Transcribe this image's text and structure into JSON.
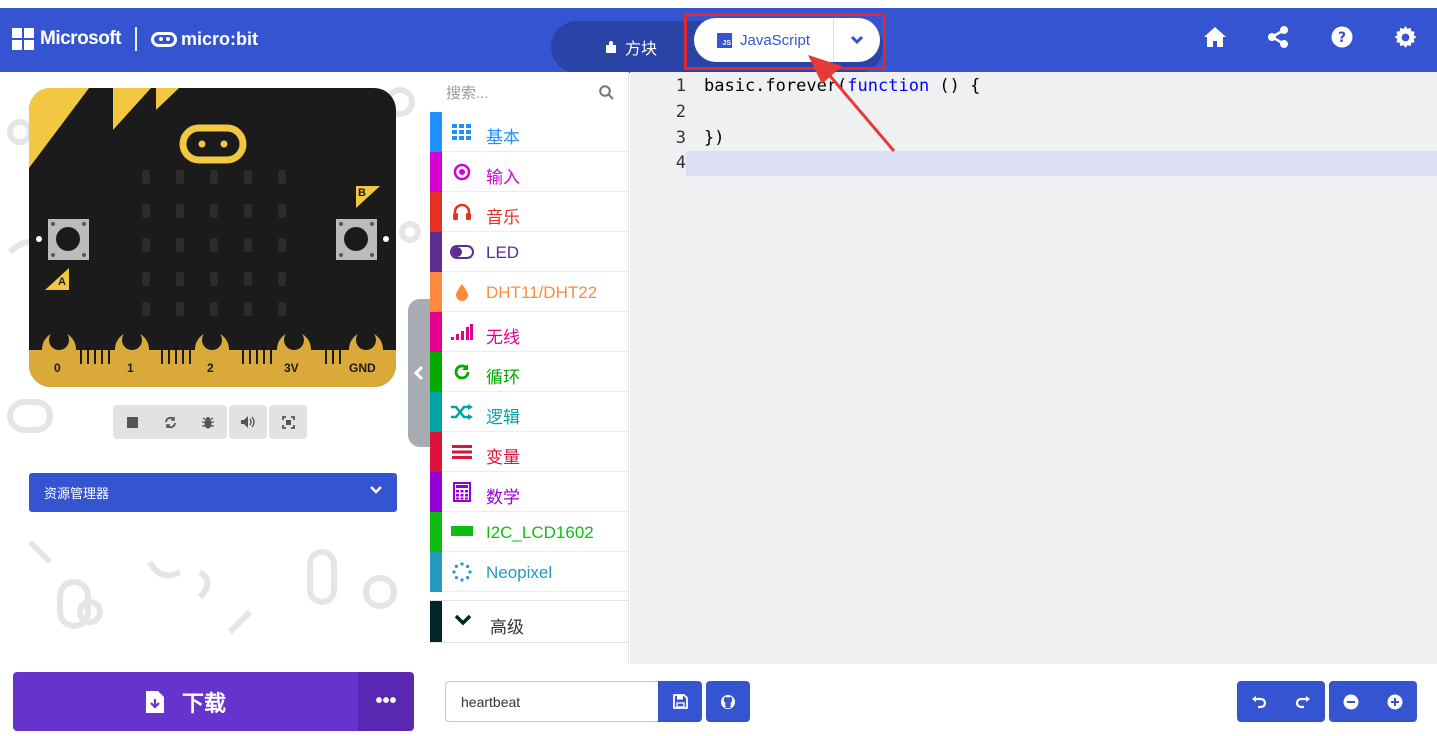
{
  "header": {
    "brand": "Microsoft",
    "product": "micro:bit",
    "mode_blocks": "方块",
    "mode_js": "JavaScript",
    "js_badge": "JS",
    "icons": [
      "home-icon",
      "share-icon",
      "help-icon",
      "settings-icon"
    ]
  },
  "simulator": {
    "pin_labels": [
      "0",
      "1",
      "2",
      "3V",
      "GND"
    ],
    "button_a": "A",
    "button_b": "B",
    "controls": [
      "stop-icon",
      "restart-icon",
      "debug-icon",
      "sound-icon",
      "fullscreen-icon"
    ],
    "explorer_label": "资源管理器"
  },
  "toolbox": {
    "search_placeholder": "搜索...",
    "categories": [
      {
        "label": "基本",
        "color": "#1e90ff",
        "icon": "grid-icon"
      },
      {
        "label": "输入",
        "color": "#d400d4",
        "icon": "target-icon"
      },
      {
        "label": "音乐",
        "color": "#e63022",
        "icon": "headphones-icon"
      },
      {
        "label": "LED",
        "color": "#5c2d91",
        "icon": "toggle-icon"
      },
      {
        "label": "DHT11/DHT22",
        "color": "#ff8a3d",
        "icon": "drop-icon"
      },
      {
        "label": "无线",
        "color": "#e3008c",
        "icon": "signal-icon"
      },
      {
        "label": "循环",
        "color": "#00aa00",
        "icon": "loop-icon"
      },
      {
        "label": "逻辑",
        "color": "#00a4a6",
        "icon": "shuffle-icon"
      },
      {
        "label": "变量",
        "color": "#dc143c",
        "icon": "list-icon"
      },
      {
        "label": "数学",
        "color": "#9400d3",
        "icon": "calculator-icon"
      },
      {
        "label": "I2C_LCD1602",
        "color": "#0fbc11",
        "icon": "rectangle-icon"
      },
      {
        "label": "Neopixel",
        "color": "#2699bf",
        "icon": "ring-icon"
      }
    ],
    "advanced": "高级",
    "advanced_color": "#02262b"
  },
  "editor": {
    "lines": [
      {
        "num": "1",
        "pre": "basic.forever(",
        "kw": "function",
        "post": " () {"
      },
      {
        "num": "2",
        "pre": "",
        "kw": "",
        "post": ""
      },
      {
        "num": "3",
        "pre": "})",
        "kw": "",
        "post": ""
      },
      {
        "num": "4",
        "pre": "",
        "kw": "",
        "post": ""
      }
    ]
  },
  "footer": {
    "download_label": "下载",
    "more_label": "•••",
    "project_name": "heartbeat"
  },
  "colors": {
    "header": "#3454d1",
    "download": "#6633cc",
    "annotation": "#e0282e"
  }
}
